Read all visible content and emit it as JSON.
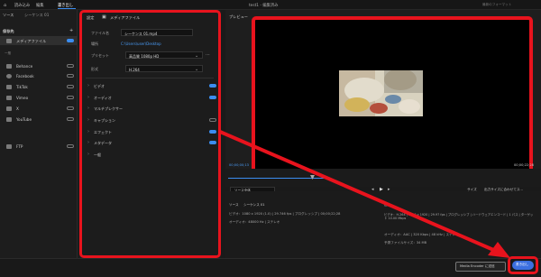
{
  "topbar": {
    "home_icon": "home-icon",
    "menu": [
      "読み込み",
      "編集",
      "書き出し"
    ],
    "title": "test1 - 編集済み",
    "right_hint": "最新のフォーマット"
  },
  "source": {
    "header": "ソース",
    "sequence": "シーケンス 01",
    "dest_header": "保存先",
    "media_file_label": "メディアファイル",
    "general_header": "一般",
    "social": [
      "Behance",
      "Facebook",
      "TikTok",
      "Vimeo",
      "X",
      "YouTube"
    ],
    "ftp": "FTP"
  },
  "settings": {
    "title_prefix": "設定",
    "title": "メディアファイル",
    "filename_label": "ファイル名",
    "filename_value": "シーケンス 01.mp4",
    "location_label": "場所",
    "location_value": "C:\\Users\\user\\Desktop",
    "preset_label": "プリセット",
    "preset_value": "高品質 1080p HD",
    "format_label": "形式",
    "format_value": "H.264",
    "sections": [
      {
        "label": "ビデオ",
        "toggle": true
      },
      {
        "label": "オーディオ",
        "toggle": true
      },
      {
        "label": "マルチプレクサー",
        "toggle": null
      },
      {
        "label": "キャプション",
        "toggle": false
      },
      {
        "label": "エフェクト",
        "toggle": true
      },
      {
        "label": "メタデータ",
        "toggle": true
      },
      {
        "label": "一般",
        "toggle": null
      }
    ]
  },
  "preview": {
    "header": "プレビュー",
    "time_start": "00;00;00;13",
    "time_end": "00;00;22;28",
    "range_label": "ソース全体",
    "fit_label": "出力サイズに合わせてス...",
    "size_prefix": "サイズ"
  },
  "summary": {
    "source_label": "ソース",
    "source_name": "シーケンス 01",
    "video_info": "ビデオ：1080 x 1920 (1.0) | 29.746 fps | プログレッシブ | 00;00;22;28",
    "audio_info": "オーディオ：48000 Hz | ステレオ",
    "output_label": "出力",
    "out_video": "ビデオ：H.264 | 1080 x 1920 | 29.97 fps | プログレッシブ | ハードウェアエンコード | 1 パス | ターゲット 10.00 Mbps",
    "out_audio": "オーディオ：AAC | 320 Kbps | 48 kHz | ステレオ",
    "filesize": "予測ファイルサイズ：34 MB"
  },
  "footer": {
    "media_encoder": "Media Encoder に送信",
    "export": "書き出し"
  },
  "colors": {
    "accent": "#3b8df0",
    "highlight": "#e8131d",
    "export_button": "#3b6fe0"
  }
}
